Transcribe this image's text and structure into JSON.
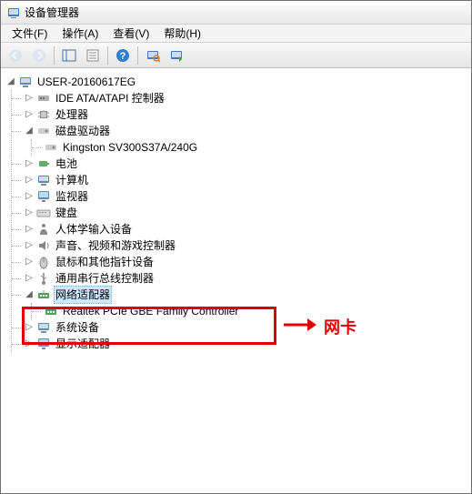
{
  "window": {
    "title": "设备管理器"
  },
  "menu": {
    "file": "文件(F)",
    "action": "操作(A)",
    "view": "查看(V)",
    "help": "帮助(H)"
  },
  "tree": {
    "root": "USER-20160617EG",
    "ide": "IDE ATA/ATAPI 控制器",
    "cpu": "处理器",
    "disk": "磁盘驱动器",
    "disk_child": "Kingston SV300S37A/240G",
    "battery": "电池",
    "computer": "计算机",
    "monitor": "监视器",
    "keyboard": "键盘",
    "hid": "人体学输入设备",
    "sound": "声音、视频和游戏控制器",
    "mouse": "鼠标和其他指针设备",
    "usb": "通用串行总线控制器",
    "network": "网络适配器",
    "network_child": "Realtek PCIe GBE Family Controller",
    "system": "系统设备",
    "display": "显示适配器"
  },
  "annotation": {
    "label": "网卡"
  }
}
